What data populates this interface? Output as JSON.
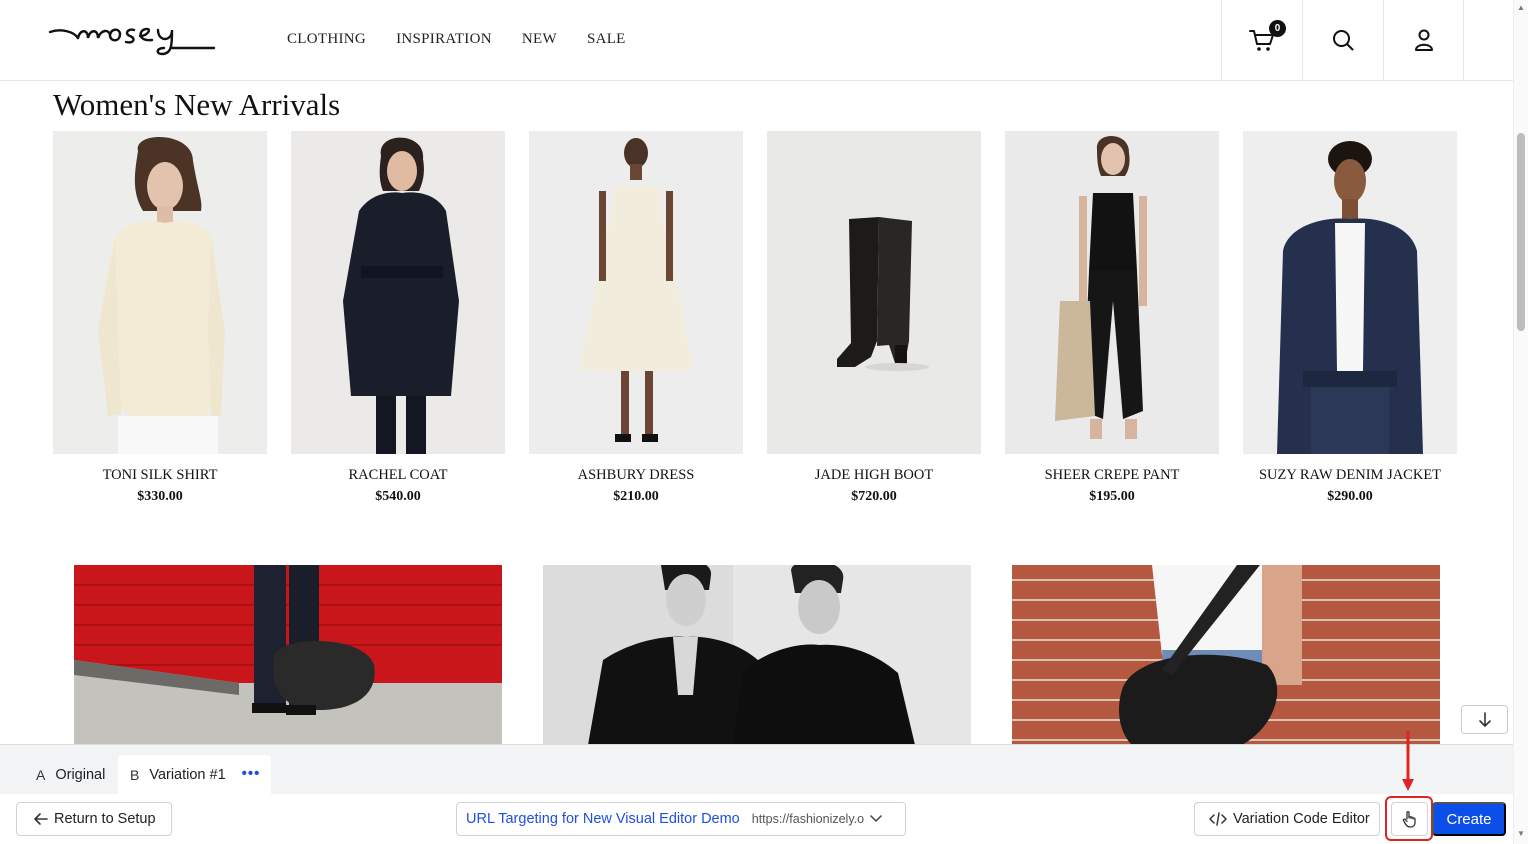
{
  "header": {
    "logo_text": "mosey",
    "nav": [
      "CLOTHING",
      "INSPIRATION",
      "NEW",
      "SALE"
    ],
    "cart_count": "0"
  },
  "main": {
    "title": "Women's New Arrivals",
    "products": [
      {
        "name": "TONI SILK SHIRT",
        "price": "$330.00"
      },
      {
        "name": "RACHEL COAT",
        "price": "$540.00"
      },
      {
        "name": "ASHBURY DRESS",
        "price": "$210.00"
      },
      {
        "name": "JADE HIGH BOOT",
        "price": "$720.00"
      },
      {
        "name": "SHEER CREPE PANT",
        "price": "$195.00"
      },
      {
        "name": "SUZY RAW DENIM JACKET",
        "price": "$290.00"
      }
    ]
  },
  "editor": {
    "tabs": [
      {
        "letter": "A",
        "label": "Original"
      },
      {
        "letter": "B",
        "label": "Variation #1",
        "more": "•••"
      }
    ],
    "return_label": "Return to Setup",
    "url_targeting_name": "URL Targeting for New Visual Editor Demo",
    "url_value": "https://fashionizely.o",
    "code_editor_label": "Variation Code Editor",
    "create_label": "Create"
  },
  "colors": {
    "accent": "#0b4fe8",
    "highlight": "#e02424",
    "banner_red": "#c8161b",
    "brick": "#b5583f"
  }
}
